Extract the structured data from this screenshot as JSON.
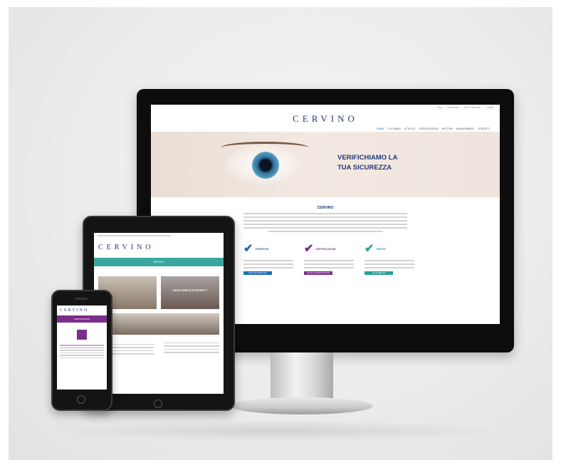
{
  "desktop": {
    "top_links": [
      "Blog",
      "Newsletter",
      "Area Riservata",
      "Contatti"
    ],
    "logo": "CERVINO",
    "nav": [
      "HOME",
      "CHI SIAMO",
      "ATTIVITÀ",
      "CERTIFICAZIONI",
      "SETTORI",
      "MANAGEMENT",
      "CONTATTI"
    ],
    "hero_title_1": "VERIFICHIAMO LA",
    "hero_title_2": "TUA SICUREZZA",
    "section_title": "CERVINO",
    "columns": [
      {
        "label": "VERIFICHE",
        "color": "#1e6fb6",
        "button": "VAI ALLE VERIFICHE"
      },
      {
        "label": "CERTIFICAZIONI",
        "color": "#7b2e8b",
        "button": "VAI ALLE CERTIFICAZIONI"
      },
      {
        "label": "SERVIZI",
        "color": "#2aa19a",
        "button": "VAI AI SERVIZI"
      }
    ]
  },
  "tablet": {
    "logo": "CERVINO",
    "band": "SERVIZI",
    "photo_captions": [
      "",
      "NUOVI SERVIZI E PROGETTI"
    ],
    "text_head": "CHI SIAMO"
  },
  "phone": {
    "logo": "CERVINO",
    "band": "CERTIFICAZIONI"
  },
  "colors": {
    "navy": "#1e3a7a",
    "teal": "#3aa79e",
    "purple": "#7b2e8b",
    "blue": "#1e6fb6"
  }
}
